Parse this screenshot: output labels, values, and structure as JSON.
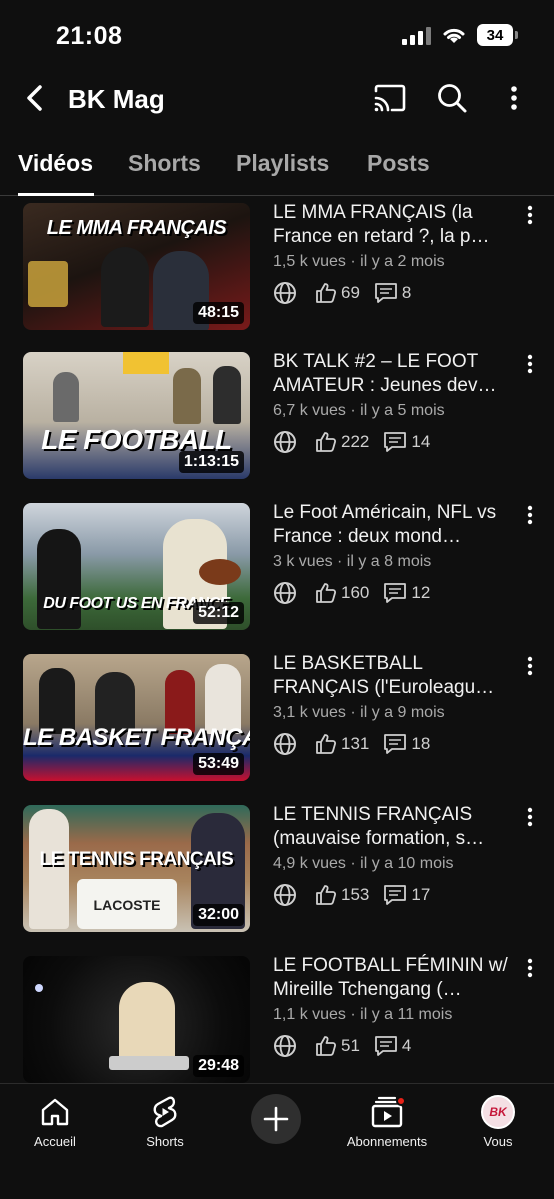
{
  "status_bar": {
    "time": "21:08",
    "battery": "34"
  },
  "header": {
    "channel_name": "BK Mag"
  },
  "tabs": [
    {
      "label": "Vidéos",
      "active": true
    },
    {
      "label": "Shorts",
      "active": false
    },
    {
      "label": "Playlists",
      "active": false
    },
    {
      "label": "Posts",
      "active": false
    }
  ],
  "videos": [
    {
      "title": "LE MMA FRANÇAIS (la France en retard ?, la p…",
      "meta": "1,5 k vues · il y a 2 mois",
      "likes": "69",
      "comments": "8",
      "duration": "48:15",
      "thumb_caption": "LE MMA FRANÇAIS"
    },
    {
      "title": "BK TALK #2 – LE FOOT AMATEUR : Jeunes dev…",
      "meta": "6,7 k vues · il y a 5 mois",
      "likes": "222",
      "comments": "14",
      "duration": "1:13:15",
      "thumb_caption": "LE FOOTBALL"
    },
    {
      "title": "Le Foot Américain, NFL vs France : deux mond…",
      "meta": "3 k vues · il y a 8 mois",
      "likes": "160",
      "comments": "12",
      "duration": "52:12",
      "thumb_caption": "DU FOOT US EN FRANCE"
    },
    {
      "title": "LE BASKETBALL FRANÇAIS (l'Euroleagu…",
      "meta": "3,1 k vues · il y a 9 mois",
      "likes": "131",
      "comments": "18",
      "duration": "53:49",
      "thumb_caption": "LE BASKET FRANÇAIS"
    },
    {
      "title": "LE TENNIS FRANÇAIS (mauvaise formation, s…",
      "meta": "4,9 k vues · il y a 10 mois",
      "likes": "153",
      "comments": "17",
      "duration": "32:00",
      "thumb_caption": "LE TENNIS FRANÇAIS"
    },
    {
      "title": "LE FOOTBALL FÉMININ w/ Mireille Tchengang (…",
      "meta": "1,1 k vues · il y a 11 mois",
      "likes": "51",
      "comments": "4",
      "duration": "29:48",
      "thumb_caption": ""
    }
  ],
  "bottom_nav": {
    "home": "Accueil",
    "shorts": "Shorts",
    "subscriptions": "Abonnements",
    "you": "Vous",
    "avatar_text": "BK"
  },
  "colors": {
    "background": "#0f0f0f",
    "text_primary": "#f1f1f1",
    "text_secondary": "#aaaaaa",
    "notification": "#e62117"
  }
}
